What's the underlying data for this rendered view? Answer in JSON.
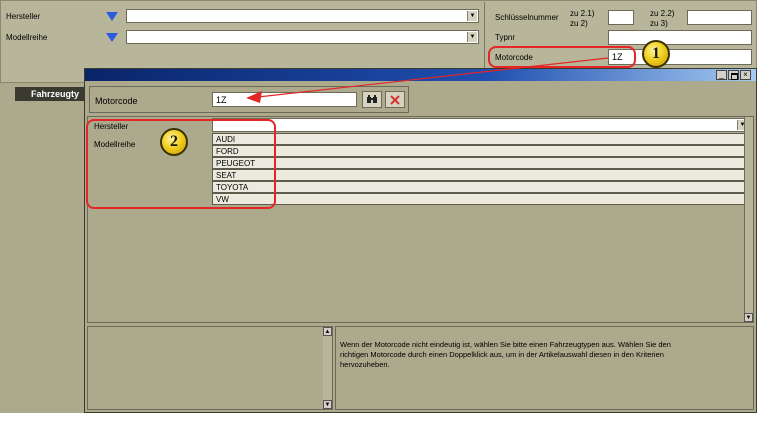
{
  "top": {
    "hersteller_label": "Hersteller",
    "modellreihe_label": "Modellreihe",
    "schluesselnummer_label": "Schlüsselnummer",
    "zu21": "zu 2.1)",
    "zu2": "zu 2)",
    "zu22": "zu 2.2)",
    "zu3": "zu 3)",
    "typnr_label": "Typnr",
    "motorcode_label": "Motorcode",
    "motorcode_value": "1Z"
  },
  "sidebar": {
    "fahrzeugtyp_label": "Fahrzeugty"
  },
  "dialog": {
    "motorcode_label": "Motorcode",
    "motorcode_value": "1Z",
    "hersteller_label": "Hersteller",
    "modellreihe_label": "Modellreihe",
    "manufacturers": [
      "AUDI",
      "FORD",
      "PEUGEOT",
      "SEAT",
      "TOYOTA",
      "VW"
    ],
    "help_text": "Wenn der Motorcode nicht eindeutig ist, wählen Sie bitte einen Fahrzeugtypen aus. Wählen Sie den richtigen Motorcode durch einen Doppelklick aus, um in der Artikelauswahl diesen in den Kriterien hervozuheben."
  },
  "badges": {
    "one": "1",
    "two": "2"
  },
  "colors": {
    "panel": "#aca98c",
    "title_bar": "#0a246a",
    "highlight": "#e32626"
  },
  "icons": [
    "filter-icon",
    "binoculars-icon",
    "clear-icon",
    "minimize-icon",
    "maximize-icon",
    "close-icon"
  ]
}
